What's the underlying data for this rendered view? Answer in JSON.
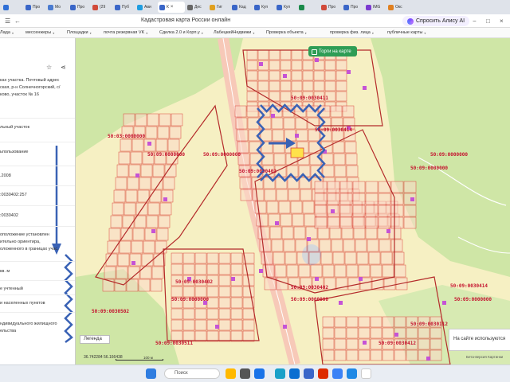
{
  "browser": {
    "tabs": [
      {
        "label": "",
        "color": "#2f6fd6"
      },
      {
        "label": "Про",
        "color": "#3a66c8"
      },
      {
        "label": "Мо",
        "color": "#4a7bd0"
      },
      {
        "label": "Про",
        "color": "#3a66c8"
      },
      {
        "label": "(29",
        "color": "#d14a3a"
      },
      {
        "label": "Пуб",
        "color": "#3a66c8"
      },
      {
        "label": "Ави",
        "color": "#1f9de0"
      },
      {
        "label": "К",
        "color": "#3a66c8",
        "active": true
      },
      {
        "label": "Дес",
        "color": "#666666"
      },
      {
        "label": "Гиг",
        "color": "#e0a020"
      },
      {
        "label": "Кад",
        "color": "#3a66c8"
      },
      {
        "label": "Куп",
        "color": "#3a66c8"
      },
      {
        "label": "Куп",
        "color": "#3a66c8"
      },
      {
        "label": "",
        "color": "#1a8a4a"
      },
      {
        "label": "Про",
        "color": "#d14a3a"
      },
      {
        "label": "Про",
        "color": "#3a66c8"
      },
      {
        "label": "IMG",
        "color": "#7b3ad0"
      },
      {
        "label": "Окс",
        "color": "#e08020"
      }
    ],
    "close_label": "×",
    "page_title": "Кадастровая карта России онлайн",
    "alice_label": "Спросить Алису AI",
    "bookmarks": [
      {
        "label": "Лада"
      },
      {
        "label": "мессенжеры"
      },
      {
        "label": "Площадки"
      },
      {
        "label": "почта резервная VK"
      },
      {
        "label": "Сделка 2.0 и Корп.у"
      },
      {
        "label": "ЛабецкийНедвижи"
      },
      {
        "label": "Проверка объекта"
      },
      {
        "label": "проверка физ. лица"
      },
      {
        "label": "публичные карты"
      }
    ]
  },
  "panel": {
    "rows": [
      "ках участка. Почтовый адрес",
      "ская, р-н Солнечногорский, с/",
      "ково, участок № 16",
      "льный участок",
      "ьпользование",
      ".2008",
      ":0030402:257",
      ":0030402",
      "оположение установлен",
      "ительно ориентира,",
      "оложенного в границах учас.",
      "кв. м",
      "е учтенный",
      "и населенных пунктов",
      "ндивидуального жилищного",
      "ельства"
    ]
  },
  "map": {
    "button_torgi": "Торги на карте",
    "legend_label": "Легенда",
    "notice_text": "На сайте используются",
    "coords": "36.742284  56.166438",
    "scale_label": "100 м",
    "footer_links": "Бета-версия   Картинки",
    "labels": [
      "50:09:0030411",
      "50:09:0030414",
      "50:03:0000000",
      "50:09:0000000",
      "50:09:0000000",
      "50:09:0000000",
      "50:09:0030402",
      "50:09:0000000",
      "50:09:0030402",
      "50:09:0000000",
      "50:09:0030402",
      "50:09:0000000",
      "50:09:0030502",
      "50:09:0030511",
      "50:09:0030414",
      "50:09:0000000",
      "50:09:0030112",
      "50:09:0030412",
      "50:09:0030112",
      "50:09:0000000"
    ]
  },
  "taskbar": {
    "search_label": "Поиск"
  }
}
